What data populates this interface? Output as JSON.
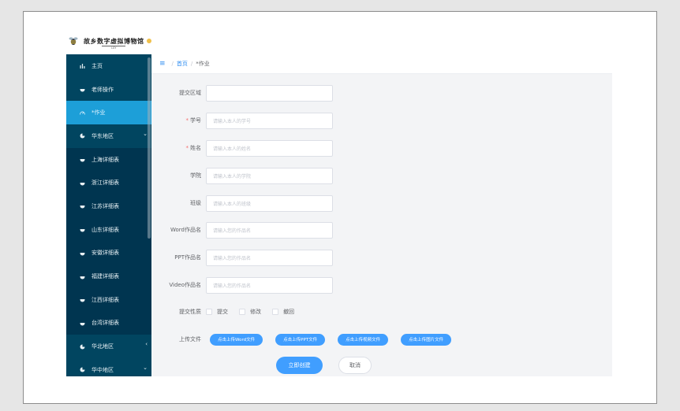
{
  "header": {
    "logo_title": "故乡数字虚拟博物馆",
    "logo_sub": "LSY"
  },
  "sidebar": {
    "items": [
      {
        "label": "主页",
        "icon": "bar-chart-icon",
        "type": "l1"
      },
      {
        "label": "老师操作",
        "icon": "circle-half-icon",
        "type": "l1"
      },
      {
        "label": "*作业",
        "icon": "speedometer-icon",
        "type": "active"
      },
      {
        "label": "华东地区",
        "icon": "circle-half-icon",
        "type": "l1",
        "arrow": "⌄"
      },
      {
        "label": "上海详细表",
        "icon": "circle-half-icon",
        "type": "sub"
      },
      {
        "label": "浙江详细表",
        "icon": "circle-half-icon",
        "type": "sub"
      },
      {
        "label": "江苏详细表",
        "icon": "circle-half-icon",
        "type": "sub"
      },
      {
        "label": "山东详细表",
        "icon": "circle-half-icon",
        "type": "sub"
      },
      {
        "label": "安徽详细表",
        "icon": "circle-half-icon",
        "type": "sub"
      },
      {
        "label": "福建详细表",
        "icon": "circle-half-icon",
        "type": "sub"
      },
      {
        "label": "江西详细表",
        "icon": "circle-half-icon",
        "type": "sub"
      },
      {
        "label": "台湾详细表",
        "icon": "circle-half-icon",
        "type": "sub"
      },
      {
        "label": "华北地区",
        "icon": "circle-half-icon",
        "type": "l1",
        "arrow": "‹"
      },
      {
        "label": "华中地区",
        "icon": "circle-half-icon",
        "type": "l1",
        "arrow": "⌄"
      }
    ]
  },
  "breadcrumb": {
    "home": "首页",
    "sep": "/",
    "current": "*作业"
  },
  "form": {
    "submit_area": {
      "label": "提交区域",
      "value": ""
    },
    "student_id": {
      "label": "学号",
      "required": "*",
      "placeholder": "请输入本人的学号"
    },
    "name": {
      "label": "姓名",
      "required": "*",
      "placeholder": "请输入本人的姓名"
    },
    "college": {
      "label": "学院",
      "placeholder": "请输入本人的学院"
    },
    "class": {
      "label": "班级",
      "placeholder": "请输入本人的班级"
    },
    "word_work": {
      "label": "Word作品名",
      "placeholder": "请输入您的作品名"
    },
    "ppt_work": {
      "label": "PPT作品名",
      "placeholder": "请输入您的作品名"
    },
    "video_work": {
      "label": "Video作品名",
      "placeholder": "请输入您的作品名"
    },
    "nature": {
      "label": "提交性质",
      "options": [
        "提交",
        "修改",
        "撤回"
      ]
    },
    "upload": {
      "label": "上传文件",
      "buttons": [
        "点击上传Word文件",
        "点击上传PPT文件",
        "点击上传视频文件",
        "点击上传图片文件"
      ]
    },
    "create_label": "立即创建",
    "cancel_label": "取消"
  },
  "colors": {
    "sidebar_bg": "#00415d",
    "active_bg": "#1d9fd8",
    "primary": "#409eff"
  }
}
